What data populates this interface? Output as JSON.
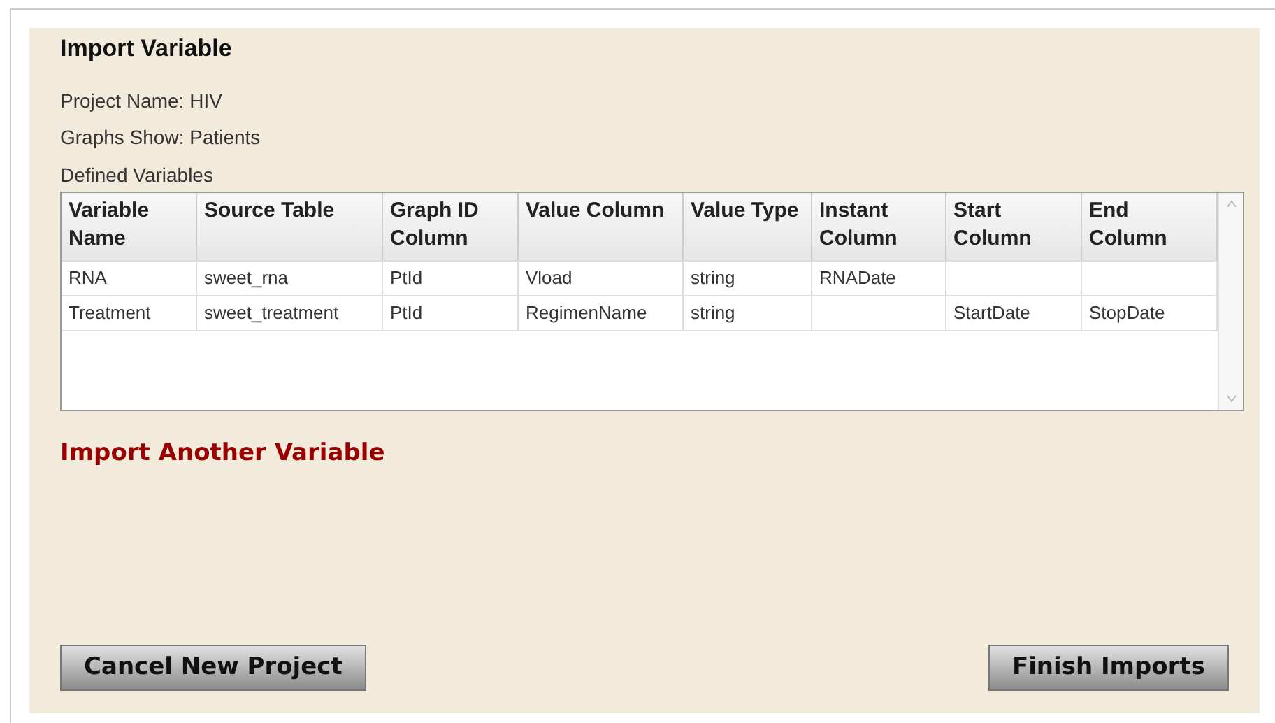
{
  "title": "Import Variable",
  "project_name": "Project Name: HIV",
  "graphs_show": "Graphs Show: Patients",
  "table_label": "Defined Variables",
  "table": {
    "columns": [
      "Variable Name",
      "Source Table",
      "Graph ID Column",
      "Value Column",
      "Value Type",
      "Instant Column",
      "Start Column",
      "End Column"
    ],
    "rows": [
      [
        "RNA",
        "sweet_rna",
        "PtId",
        "Vload",
        "string",
        "RNADate",
        "",
        ""
      ],
      [
        "Treatment",
        "sweet_treatment",
        "PtId",
        "RegimenName",
        "string",
        "",
        "StartDate",
        "StopDate"
      ]
    ]
  },
  "import_link": "Import Another Variable",
  "buttons": {
    "cancel": "Cancel New Project",
    "finish": "Finish Imports"
  }
}
